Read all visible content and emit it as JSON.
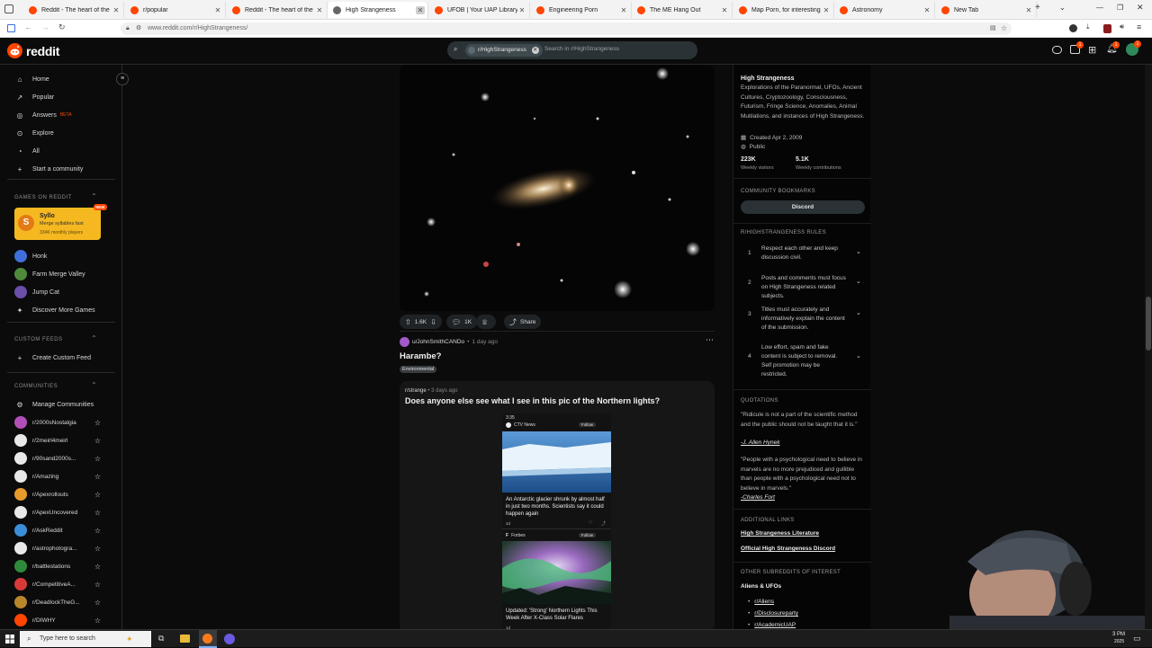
{
  "browser": {
    "tabs": [
      {
        "label": "Reddit - The heart of the internet",
        "active": false
      },
      {
        "label": "r/popular",
        "active": false
      },
      {
        "label": "Reddit - The heart of the internet",
        "active": false
      },
      {
        "label": "High Strangeness",
        "active": true
      },
      {
        "label": "UFOB | Your UAP Library",
        "active": false
      },
      {
        "label": "Engineering Porn",
        "active": false
      },
      {
        "label": "The ME Hang Out",
        "active": false
      },
      {
        "label": "Map Porn, for interesting maps",
        "active": false
      },
      {
        "label": "Astronomy",
        "active": false
      },
      {
        "label": "New Tab",
        "active": false
      }
    ],
    "new_tab_symbol": "+",
    "url": "www.reddit.com/r/HighStrangeness/"
  },
  "header": {
    "logo_text": "reddit",
    "search_chip": "r/HighStrangeness",
    "search_placeholder": "Search in r/HighStrangeness",
    "notification_badges": [
      "1",
      "1",
      "1"
    ]
  },
  "sidebar": {
    "nav": [
      {
        "label": "Home",
        "icon": "home-icon",
        "glyph": "⌂"
      },
      {
        "label": "Popular",
        "icon": "popular-icon",
        "glyph": "↗"
      },
      {
        "label": "Answers",
        "icon": "answers-icon",
        "glyph": "◎",
        "badge": "BETA"
      },
      {
        "label": "Explore",
        "icon": "explore-icon",
        "glyph": "⊙"
      },
      {
        "label": "All",
        "icon": "all-icon",
        "glyph": "◔"
      },
      {
        "label": "Start a community",
        "icon": "plus-icon",
        "glyph": "+"
      }
    ],
    "games_header": "GAMES ON REDDIT",
    "featured_game": {
      "name": "Syllo",
      "desc": "Merge syllables fast",
      "players": "334K monthly players",
      "badge": "NEW"
    },
    "games": [
      {
        "label": "Honk",
        "color": "#3f6fd8"
      },
      {
        "label": "Farm Merge Valley",
        "color": "#4f8a3b"
      },
      {
        "label": "Jump Cat",
        "color": "#6b4fa8"
      },
      {
        "label": "Discover More Games",
        "color": ""
      }
    ],
    "custom_feeds_header": "CUSTOM FEEDS",
    "create_feed": "Create Custom Feed",
    "communities_header": "COMMUNITIES",
    "manage": "Manage Communities",
    "communities": [
      {
        "label": "r/2000sNostalgia",
        "color": "#b04fb8"
      },
      {
        "label": "r/2meirl4meirl",
        "color": "#e8e8e8"
      },
      {
        "label": "r/90sand2000s...",
        "color": "#e8e8e8"
      },
      {
        "label": "r/Amazing",
        "color": "#e8e8e8"
      },
      {
        "label": "r/Apexrollouts",
        "color": "#e89b2b"
      },
      {
        "label": "r/ApexUncovered",
        "color": "#e8e8e8"
      },
      {
        "label": "r/AskReddit",
        "color": "#3a8fd8"
      },
      {
        "label": "r/astrophotogra...",
        "color": "#e8e8e8"
      },
      {
        "label": "r/battlestations",
        "color": "#2f8a3b"
      },
      {
        "label": "r/CompetitiveA...",
        "color": "#d83a3a"
      },
      {
        "label": "r/DeadlockTheG...",
        "color": "#b8862b"
      },
      {
        "label": "r/DIWHY",
        "color": "#ff4500"
      }
    ]
  },
  "post1": {
    "upvotes": "1.6K",
    "comments": "1K",
    "share": "Share"
  },
  "post2": {
    "author": "u/JohnSmithCANDo",
    "time": "1 day ago",
    "title": "Harambe?",
    "flair": "Environmental",
    "embed_sub": "r/strange",
    "embed_time": "3 days ago",
    "embed_title": "Does anyone else see what I see in this pic of the Northern lights?",
    "phone": {
      "time": "3:35",
      "source1": "CTV News",
      "follow": "Follow",
      "headline1": "An Antarctic glacier shrunk by almost half in just two months. Scientists say it could happen again",
      "age1": "3d",
      "source2": "Forbes",
      "headline2": "Updated: 'Strong' Northern Lights This Week After X-Class Solar Flares",
      "age2": "1d"
    }
  },
  "right": {
    "title": "High Strangeness",
    "desc": "Explorations of the Paranormal, UFOs, Ancient Cultures, Cryptozoology, Consciousness, Futurism, Fringe Science, Anomalies, Animal Mutilations, and instances of High Strangeness.",
    "created": "Created Apr 2, 2009",
    "visibility": "Public",
    "visitors": "223K",
    "visitors_label": "Weekly visitors",
    "contribs": "5.1K",
    "contribs_label": "Weekly contributions",
    "bookmarks_header": "COMMUNITY BOOKMARKS",
    "bookmark_btn": "Discord",
    "rules_header": "R/HIGHSTRANGENESS RULES",
    "rules": [
      {
        "n": "1",
        "text": "Respect each other and keep discussion civil."
      },
      {
        "n": "2",
        "text": "Posts and comments must focus on High Strangeness related subjects."
      },
      {
        "n": "3",
        "text": "Titles must accurately and informatively explain the content of the submission."
      },
      {
        "n": "4",
        "text": "Low effort, spam and fake content is subject to removal. Self promotion may be restricted."
      }
    ],
    "quotations_header": "QUOTATIONS",
    "quote1": "\"Ridicule is not a part of the scientific method and the public should not be taught that it is.\"",
    "quote1_author": "-J. Allen Hynek",
    "quote2": "\"People with a psychological need to believe in marvels are no more prejudiced and gullible than people with a psychological need not to believe in marvels.\"",
    "quote2_author": "-Charles Fort",
    "links_header": "ADDITIONAL LINKS",
    "link1": "High Strangeness Literature",
    "link2": "Official High Strangeness Discord",
    "other_header": "OTHER SUBREDDITS OF INTEREST",
    "other_title": "Aliens & UFOs",
    "others": [
      "r/Aliens",
      "r/Disclosureparty",
      "r/AcademicUAP"
    ]
  },
  "taskbar": {
    "search_placeholder": "Type here to search",
    "time": "3 PM",
    "date": "2025"
  }
}
